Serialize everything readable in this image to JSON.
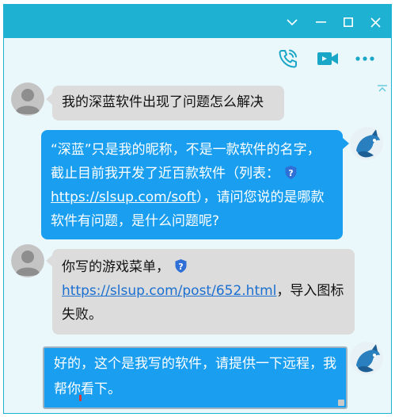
{
  "window": {
    "controls": {
      "menu_icon": "chevron-down-icon",
      "minimize_icon": "minimize-icon",
      "maximize_icon": "maximize-icon",
      "close_icon": "close-icon"
    },
    "accent_color": "#1fb1d2"
  },
  "toolbar": {
    "voice_call_icon": "phone-call-icon",
    "video_call_icon": "video-call-icon",
    "more_icon": "more-dots-icon"
  },
  "messages": [
    {
      "direction": "incoming",
      "avatar": "default-user-avatar",
      "text": "我的深蓝软件出现了问题怎么解决"
    },
    {
      "direction": "outgoing",
      "avatar": "blue-fox-avatar",
      "text_before_link": "“深蓝”只是我的昵称，不是一款软件的名字，截止目前我开发了近百款软件（列表：",
      "link": "https://slsup.com/soft",
      "text_after_link": "），请问您说的是哪款软件有问题，是什么问题呢?"
    },
    {
      "direction": "incoming",
      "avatar": "default-user-avatar",
      "text_before_link": "你写的游戏菜单，",
      "link": "https://slsup.com/post/652.html",
      "text_after_link": "，导入图标失败。"
    }
  ],
  "composer": {
    "text": "好的，这个是我写的软件，请提供一下远程，我帮你看下。",
    "avatar": "blue-fox-avatar"
  },
  "colors": {
    "incoming_bubble": "#dcdcdc",
    "outgoing_bubble": "#1a9ff0",
    "chat_background": "#eaf7fb"
  }
}
